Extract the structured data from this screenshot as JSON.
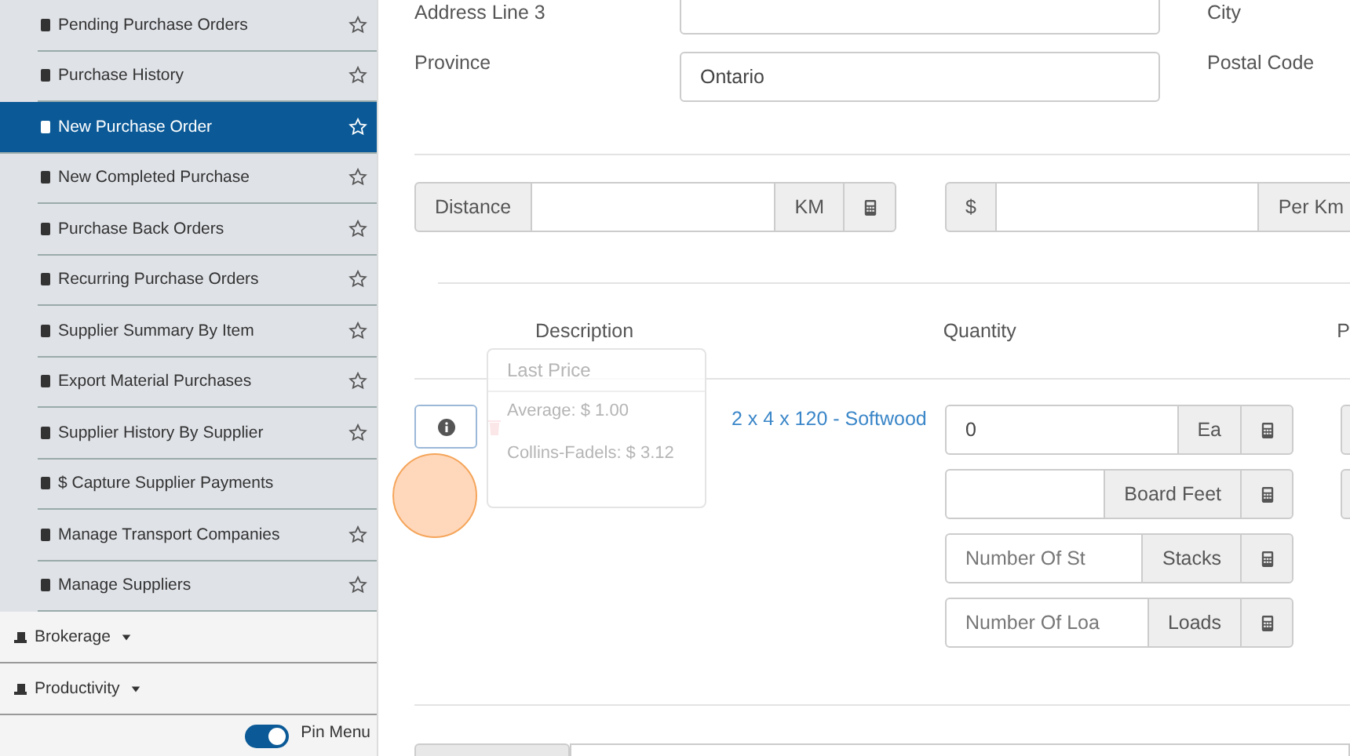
{
  "sidebar": {
    "items": [
      {
        "label": "Pending Purchase Orders",
        "selected": false,
        "starred": true
      },
      {
        "label": "Purchase History",
        "selected": false,
        "starred": true
      },
      {
        "label": "New Purchase Order",
        "selected": true,
        "starred": true
      },
      {
        "label": "New Completed Purchase",
        "selected": false,
        "starred": true
      },
      {
        "label": "Purchase Back Orders",
        "selected": false,
        "starred": true
      },
      {
        "label": "Recurring Purchase Orders",
        "selected": false,
        "starred": true
      },
      {
        "label": "Supplier Summary By Item",
        "selected": false,
        "starred": true
      },
      {
        "label": "Export Material Purchases",
        "selected": false,
        "starred": true
      },
      {
        "label": "Supplier History By Supplier",
        "selected": false,
        "starred": true
      },
      {
        "label": "$ Capture Supplier Payments",
        "selected": false,
        "starred": false
      },
      {
        "label": "Manage Transport Companies",
        "selected": false,
        "starred": true
      },
      {
        "label": "Manage Suppliers",
        "selected": false,
        "starred": true
      }
    ],
    "sections": [
      {
        "label": "Brokerage",
        "expanded": false
      },
      {
        "label": "Productivity",
        "expanded": false
      }
    ],
    "pin_menu": {
      "label": "Pin Menu",
      "on": true
    }
  },
  "address": [
    {
      "label": "Address Line 3",
      "label_2": "City"
    },
    {
      "label": "Province",
      "value": "Ontario",
      "label_2": "Postal Code"
    }
  ],
  "distance": {
    "label": "Distance",
    "unit": "KM",
    "currency": "$",
    "per": "Per Km"
  },
  "lines": {
    "columns": [
      "Description",
      "Quantity",
      "P"
    ],
    "item": {
      "description": "2 x 4 x 120 - Softwood",
      "quantity": [
        {
          "value": "0",
          "unit": "Ea"
        },
        {
          "unit": "Board Feet"
        },
        {
          "placeholder": "Number Of St",
          "unit": "Stacks"
        },
        {
          "placeholder": "Number Of Loa",
          "unit": "Loads"
        }
      ]
    }
  },
  "tooltip": {
    "title": "Last Price",
    "rows": [
      "Average: $ 1.00",
      "Collins-Fadels: $ 3.12"
    ]
  }
}
